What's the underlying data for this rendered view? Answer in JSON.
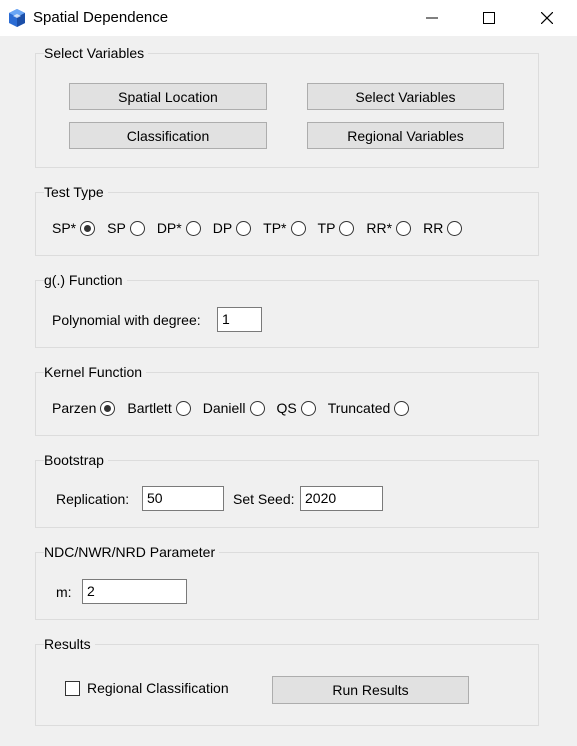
{
  "window": {
    "title": "Spatial Dependence",
    "minimize_icon": "minimize-icon",
    "maximize_icon": "maximize-icon",
    "close_icon": "close-icon"
  },
  "select_variables": {
    "group_label": "Select Variables",
    "buttons": [
      "Spatial Location",
      "Select Variables",
      "Classification",
      "Regional Variables"
    ]
  },
  "test_type": {
    "group_label": "Test Type",
    "options": [
      "SP*",
      "SP",
      "DP*",
      "DP",
      "TP*",
      "TP",
      "RR*",
      "RR"
    ],
    "selected": "SP*"
  },
  "g_function": {
    "group_label": "g(.) Function",
    "field_label": "Polynomial with degree:",
    "value": "1"
  },
  "kernel_function": {
    "group_label": "Kernel Function",
    "options": [
      "Parzen",
      "Bartlett",
      "Daniell",
      "QS",
      "Truncated"
    ],
    "selected": "Parzen"
  },
  "bootstrap": {
    "group_label": "Bootstrap",
    "replication_label": "Replication:",
    "replication_value": "50",
    "seed_label": "Set Seed:",
    "seed_value": "2020"
  },
  "parameter": {
    "group_label": "NDC/NWR/NRD Parameter",
    "m_label": "m:",
    "m_value": "2"
  },
  "results": {
    "group_label": "Results",
    "checkbox_label": "Regional Classification",
    "checkbox_checked": false,
    "run_label": "Run Results"
  }
}
